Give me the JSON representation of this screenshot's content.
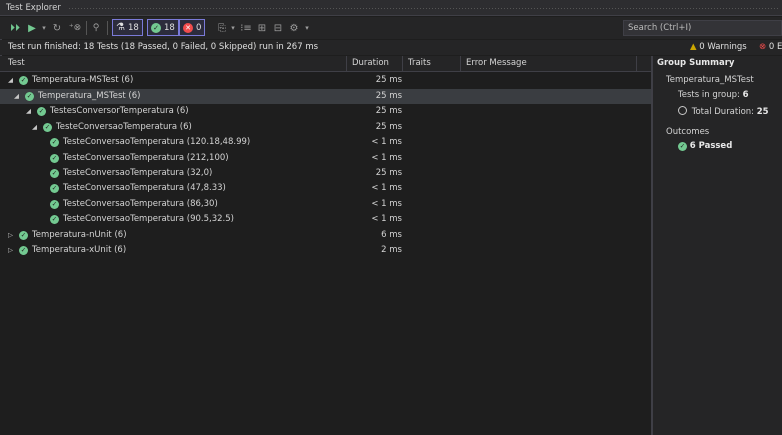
{
  "window": {
    "title": "Test Explorer"
  },
  "toolbar": {
    "run_all_icon": "run-all-icon",
    "run_icon": "run-icon",
    "refresh_icon": "refresh-icon",
    "cancel_icon": "cancel-icon",
    "filter_icon": "filter-icon",
    "total_count": "18",
    "passed_count": "18",
    "failed_count": "0",
    "search_placeholder": "Search (Ctrl+I)"
  },
  "status": {
    "message": "Test run finished: 18 Tests (18 Passed, 0 Failed, 0 Skipped) run in 267 ms",
    "warnings": "0 Warnings",
    "errors": "0 E"
  },
  "columns": {
    "test": "Test",
    "duration": "Duration",
    "traits": "Traits",
    "error": "Error Message"
  },
  "rows": [
    {
      "label": "Temperatura-MSTest (6)",
      "duration": "25 ms",
      "expand": "◢"
    },
    {
      "label": "Temperatura_MSTest (6)",
      "duration": "25 ms",
      "expand": "◢"
    },
    {
      "label": "TestesConversorTemperatura (6)",
      "duration": "25 ms",
      "expand": "◢"
    },
    {
      "label": "TesteConversaoTemperatura (6)",
      "duration": "25 ms",
      "expand": "◢"
    },
    {
      "label": "TesteConversaoTemperatura (120.18,48.99)",
      "duration": "< 1 ms",
      "expand": ""
    },
    {
      "label": "TesteConversaoTemperatura (212,100)",
      "duration": "< 1 ms",
      "expand": ""
    },
    {
      "label": "TesteConversaoTemperatura (32,0)",
      "duration": "25 ms",
      "expand": ""
    },
    {
      "label": "TesteConversaoTemperatura (47,8.33)",
      "duration": "< 1 ms",
      "expand": ""
    },
    {
      "label": "TesteConversaoTemperatura (86,30)",
      "duration": "< 1 ms",
      "expand": ""
    },
    {
      "label": "TesteConversaoTemperatura (90.5,32.5)",
      "duration": "< 1 ms",
      "expand": ""
    },
    {
      "label": "Temperatura-nUnit (6)",
      "duration": "6 ms",
      "expand": "▷"
    },
    {
      "label": "Temperatura-xUnit (6)",
      "duration": "2 ms",
      "expand": "▷"
    }
  ],
  "summary": {
    "heading": "Group Summary",
    "group_name": "Temperatura_MSTest",
    "tests_label": "Tests in group:",
    "tests_value": "6",
    "duration_label": "Total Duration:",
    "duration_value": "25",
    "outcomes_label": "Outcomes",
    "passed_label": "6 Passed"
  },
  "colors": {
    "pass": "#73c991",
    "fail": "#f14c4c",
    "warning": "#cca700",
    "accent": "#7a7ad8"
  }
}
